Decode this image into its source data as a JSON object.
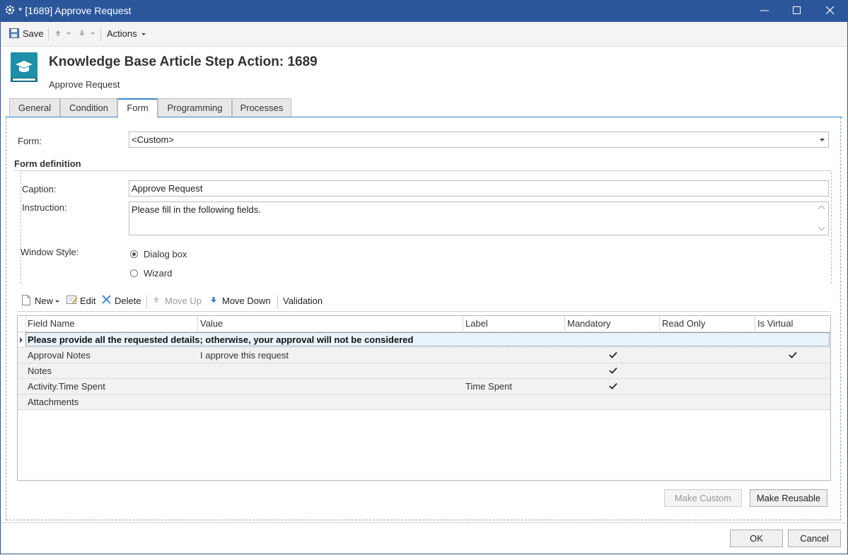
{
  "window": {
    "title": "* [1689] Approve Request"
  },
  "toolbar": {
    "save_label": "Save",
    "actions_label": "Actions"
  },
  "header": {
    "title": "Knowledge Base Article Step Action: 1689",
    "subtitle": "Approve Request"
  },
  "tabs": [
    {
      "label": "General"
    },
    {
      "label": "Condition"
    },
    {
      "label": "Form"
    },
    {
      "label": "Programming"
    },
    {
      "label": "Processes"
    }
  ],
  "form": {
    "form_label": "Form:",
    "form_value": "<Custom>",
    "section_title": "Form definition",
    "caption_label": "Caption:",
    "caption_value": "Approve Request",
    "instruction_label": "Instruction:",
    "instruction_value": "Please fill in the following fields.",
    "window_style_label": "Window Style:",
    "window_style_options": [
      "Dialog box",
      "Wizard"
    ],
    "window_style_selected": "Dialog box"
  },
  "grid_toolbar": {
    "new_label": "New",
    "edit_label": "Edit",
    "delete_label": "Delete",
    "move_up_label": "Move Up",
    "move_down_label": "Move Down",
    "validation_label": "Validation"
  },
  "grid": {
    "columns": [
      "Field Name",
      "Value",
      "Label",
      "Mandatory",
      "Read Only",
      "Is Virtual"
    ],
    "group_row": "Please provide all the requested details; otherwise, your approval will not be considered",
    "rows": [
      {
        "field_name": "Approval Notes",
        "value": "I approve this request",
        "label": "",
        "mandatory": true,
        "read_only": false,
        "is_virtual": true
      },
      {
        "field_name": "Notes",
        "value": "",
        "label": "",
        "mandatory": true,
        "read_only": false,
        "is_virtual": false
      },
      {
        "field_name": "Activity.Time Spent",
        "value": "",
        "label": "Time Spent",
        "mandatory": true,
        "read_only": false,
        "is_virtual": false
      },
      {
        "field_name": "Attachments",
        "value": "",
        "label": "",
        "mandatory": false,
        "read_only": false,
        "is_virtual": false
      }
    ]
  },
  "buttons": {
    "make_custom": "Make Custom",
    "make_reusable": "Make Reusable",
    "ok": "OK",
    "cancel": "Cancel"
  },
  "colors": {
    "titlebar": "#2b579a",
    "accent": "#3a86c8",
    "icon_teal": "#1e8fa8"
  }
}
